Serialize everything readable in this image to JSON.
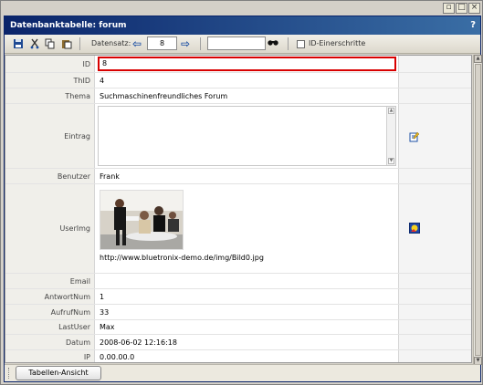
{
  "window": {
    "controls": [
      "▫",
      "□",
      "×"
    ],
    "title": "Datenbanktabelle: forum",
    "help": "?"
  },
  "toolbar": {
    "icons": [
      "save-icon",
      "cut-icon",
      "copy-icon",
      "paste-icon"
    ],
    "record_label": "Datensatz:",
    "record_value": "8",
    "search_value": "",
    "id_steps_label": "ID-Einerschritte",
    "id_steps_checked": false
  },
  "fields": {
    "id": {
      "label": "ID",
      "value": "8"
    },
    "thid": {
      "label": "ThID",
      "value": "4"
    },
    "thema": {
      "label": "Thema",
      "value": "Suchmaschinenfreundliches Forum"
    },
    "eintrag": {
      "label": "Eintrag",
      "value": ""
    },
    "benutzer": {
      "label": "Benutzer",
      "value": "Frank"
    },
    "userimg": {
      "label": "UserImg",
      "url": "http://www.bluetronix-demo.de/img/Bild0.jpg"
    },
    "email": {
      "label": "Email",
      "value": ""
    },
    "antwortnum": {
      "label": "AntwortNum",
      "value": "1"
    },
    "aufrufnum": {
      "label": "AufrufNum",
      "value": "33"
    },
    "lastuser": {
      "label": "LastUser",
      "value": "Max"
    },
    "datum": {
      "label": "Datum",
      "value": "2008-06-02 12:16:18"
    },
    "ip": {
      "label": "IP",
      "value": "0.00.00.0"
    }
  },
  "bottom": {
    "view_button": "Tabellen-Ansicht"
  },
  "colors": {
    "titlebar_start": "#0a246a",
    "titlebar_end": "#3a6ea5",
    "id_highlight": "#d80000"
  }
}
